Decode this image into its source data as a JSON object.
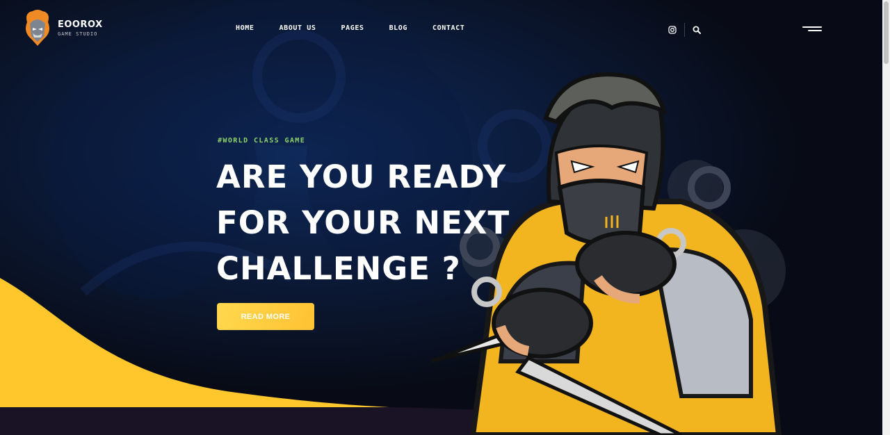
{
  "brand": {
    "name": "EOOROX",
    "tagline": "GAME STUDIO"
  },
  "nav": {
    "items": [
      {
        "label": "HOME"
      },
      {
        "label": "ABOUT US"
      },
      {
        "label": "PAGES"
      },
      {
        "label": "BLOG"
      },
      {
        "label": "CONTACT"
      }
    ]
  },
  "header_icons": {
    "social": "instagram-icon",
    "search": "search-icon",
    "menu": "hamburger-menu-icon"
  },
  "hero": {
    "tagline": "#WORLD CLASS GAME",
    "headline_lines": [
      "ARE YOU READY",
      "FOR YOUR NEXT",
      "CHALLENGE ?"
    ],
    "cta_label": "READ MORE"
  },
  "colors": {
    "accent_yellow": "#ffc72c",
    "tagline_green": "#8dd46a",
    "background_navy": "#0b0f1c",
    "section_purple": "#1a1326"
  }
}
